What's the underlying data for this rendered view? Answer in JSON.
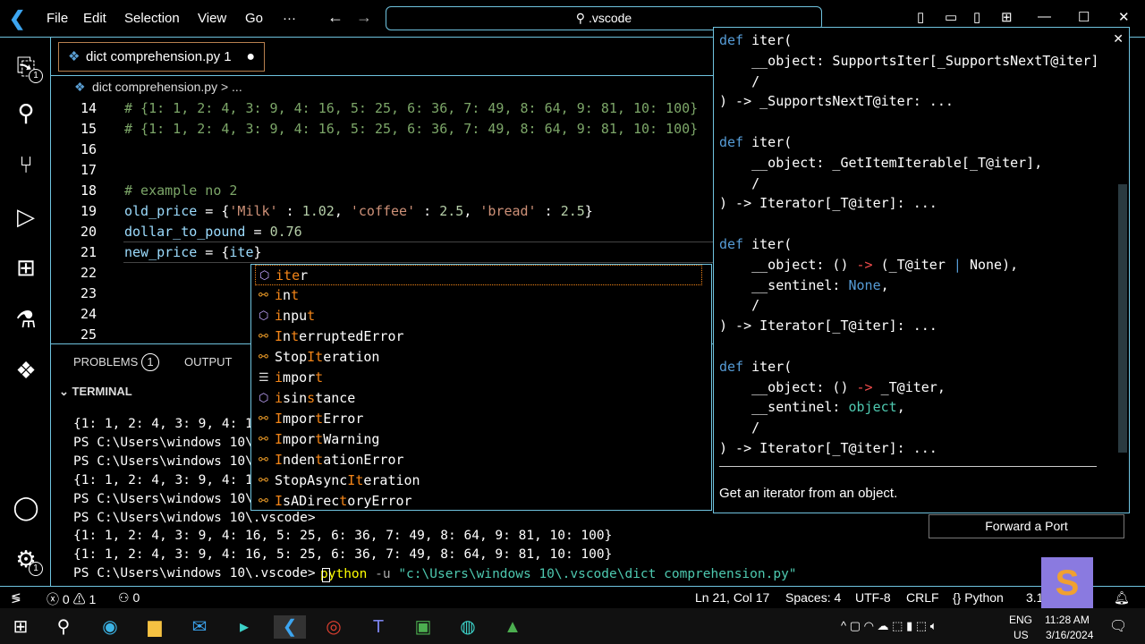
{
  "menu": [
    "File",
    "Edit",
    "Selection",
    "View",
    "Go",
    "···"
  ],
  "search": ".vscode",
  "tab": {
    "label": "dict comprehension.py",
    "problems": "1"
  },
  "breadcrumb": {
    "file": "dict comprehension.py",
    "rest": "> ..."
  },
  "activity_badges": {
    "explorer": "1",
    "settings": "1"
  },
  "lines": [
    {
      "n": "14",
      "seg": [
        [
          "# {1: 1, 2: 4, 3: 9, 4: 16, 5: 25, 6: 36, 7: 49, 8: 64, 9: 81, 10: 100}",
          "com"
        ]
      ]
    },
    {
      "n": "15",
      "seg": [
        [
          "# {1: 1, 2: 4, 3: 9, 4: 16, 5: 25, 6: 36, 7: 49, 8: 64, 9: 81, 10: 100}",
          "com"
        ]
      ]
    },
    {
      "n": "16",
      "seg": []
    },
    {
      "n": "17",
      "seg": []
    },
    {
      "n": "18",
      "seg": [
        [
          "# example no 2",
          "com"
        ]
      ]
    },
    {
      "n": "19",
      "seg": [
        [
          "old_price",
          "var"
        ],
        [
          " = {",
          "op"
        ],
        [
          "'Milk'",
          "str"
        ],
        [
          " : ",
          "op"
        ],
        [
          "1.02",
          "num"
        ],
        [
          ", ",
          "op"
        ],
        [
          "'coffee'",
          "str"
        ],
        [
          " : ",
          "op"
        ],
        [
          "2.5",
          "num"
        ],
        [
          ", ",
          "op"
        ],
        [
          "'bread'",
          "str"
        ],
        [
          " : ",
          "op"
        ],
        [
          "2.5",
          "num"
        ],
        [
          "}",
          "op"
        ]
      ]
    },
    {
      "n": "20",
      "seg": [
        [
          "dollar_to_pound",
          "var"
        ],
        [
          " = ",
          "op"
        ],
        [
          "0.76",
          "num"
        ]
      ]
    },
    {
      "n": "21",
      "seg": [
        [
          "new_price",
          "var"
        ],
        [
          " = {",
          "op"
        ],
        [
          "ite",
          "var"
        ],
        [
          "}",
          "op"
        ]
      ]
    },
    {
      "n": "22",
      "seg": []
    },
    {
      "n": "23",
      "seg": []
    },
    {
      "n": "24",
      "seg": []
    },
    {
      "n": "25",
      "seg": []
    }
  ],
  "panel": {
    "problems": "PROBLEMS",
    "problems_count": "1",
    "output": "OUTPUT",
    "terminal": "TERMINAL"
  },
  "terminal": [
    "{1: 1, 2: 4, 3: 9, 4: 1",
    "PS C:\\Users\\windows 10\\",
    "PS C:\\Users\\windows 10\\",
    "{1: 1, 2: 4, 3: 9, 4: 1",
    "PS C:\\Users\\windows 10\\",
    "PS C:\\Users\\windows 10\\.vscode> ",
    "{1: 1, 2: 4, 3: 9, 4: 16, 5: 25, 6: 36, 7: 49, 8: 64, 9: 81, 10: 100}",
    "{1: 1, 2: 4, 3: 9, 4: 16, 5: 25, 6: 36, 7: 49, 8: 64, 9: 81, 10: 100}",
    "PS C:\\Users\\windows 10\\.vscode> "
  ],
  "terminal_cmd": {
    "python": "python",
    "flag": " -u ",
    "path": "\"c:\\Users\\windows 10\\.vscode\\dict comprehension.py\""
  },
  "suggestions": [
    {
      "label": "iter",
      "icon": "function",
      "hl": [
        0,
        1,
        2
      ]
    },
    {
      "label": "int",
      "icon": "class",
      "hl": [
        0,
        2
      ]
    },
    {
      "label": "input",
      "icon": "function",
      "hl": [
        0,
        4
      ]
    },
    {
      "label": "InterruptedError",
      "icon": "class",
      "hl": [
        0,
        2
      ]
    },
    {
      "label": "StopIteration",
      "icon": "class",
      "hl": [
        4,
        5
      ]
    },
    {
      "label": "import",
      "icon": "keyword",
      "hl": [
        0,
        5
      ]
    },
    {
      "label": "isinstance",
      "icon": "function",
      "hl": [
        0,
        4
      ]
    },
    {
      "label": "ImportError",
      "icon": "class",
      "hl": [
        0,
        5
      ]
    },
    {
      "label": "ImportWarning",
      "icon": "class",
      "hl": [
        0,
        5
      ]
    },
    {
      "label": "IndentationError",
      "icon": "class",
      "hl": [
        0,
        5
      ]
    },
    {
      "label": "StopAsyncIteration",
      "icon": "class",
      "hl": [
        9,
        10
      ]
    },
    {
      "label": "IsADirectoryError",
      "icon": "class",
      "hl": [
        0,
        8
      ]
    }
  ],
  "hover": {
    "lines": [
      [
        [
          "def ",
          "kw"
        ],
        [
          "iter(",
          ""
        ]
      ],
      [
        [
          "    __object: SupportsIter[_SupportsNextT@iter]",
          ""
        ]
      ],
      [
        [
          "    /",
          ""
        ]
      ],
      [
        [
          ") -> _SupportsNextT@iter: ...",
          ""
        ]
      ],
      [
        [
          "",
          ""
        ]
      ],
      [
        [
          "def ",
          "kw"
        ],
        [
          "iter(",
          ""
        ]
      ],
      [
        [
          "    __object: _GetItemIterable[_T@iter],",
          ""
        ]
      ],
      [
        [
          "    /",
          ""
        ]
      ],
      [
        [
          ") -> Iterator[_T@iter]: ...",
          ""
        ]
      ],
      [
        [
          "",
          ""
        ]
      ],
      [
        [
          "def ",
          "kw"
        ],
        [
          "iter(",
          ""
        ]
      ],
      [
        [
          "    __object: () ",
          ""
        ],
        [
          "->",
          "rd"
        ],
        [
          " (_T@iter ",
          ""
        ],
        [
          "|",
          "bl"
        ],
        [
          " None",
          ""
        ],
        [
          "),",
          ""
        ]
      ],
      [
        [
          "    __sentinel: ",
          ""
        ],
        [
          "None",
          "bl"
        ],
        [
          ",",
          ""
        ]
      ],
      [
        [
          "    /",
          ""
        ]
      ],
      [
        [
          ") -> Iterator[_T@iter]: ...",
          ""
        ]
      ],
      [
        [
          "",
          ""
        ]
      ],
      [
        [
          "def ",
          "kw"
        ],
        [
          "iter(",
          ""
        ]
      ],
      [
        [
          "    __object: () ",
          ""
        ],
        [
          "->",
          "rd"
        ],
        [
          " _T@iter,",
          ""
        ]
      ],
      [
        [
          "    __sentinel: ",
          ""
        ],
        [
          "object",
          "ty"
        ],
        [
          ",",
          ""
        ]
      ],
      [
        [
          "    /",
          ""
        ]
      ],
      [
        [
          ") -> Iterator[_T@iter]: ...",
          ""
        ]
      ]
    ],
    "doc": "Get an iterator from an object."
  },
  "forward_port": "Forward a Port",
  "status": {
    "errors": "0",
    "warnings": "1",
    "ports": "0",
    "position": "Ln 21, Col 17",
    "spaces": "Spaces: 4",
    "encoding": "UTF-8",
    "eol": "CRLF",
    "language": "Python",
    "version": "3.1"
  },
  "tray": {
    "lang1": "ENG",
    "lang2": "US",
    "time": "11:28 AM",
    "date": "3/16/2024"
  }
}
